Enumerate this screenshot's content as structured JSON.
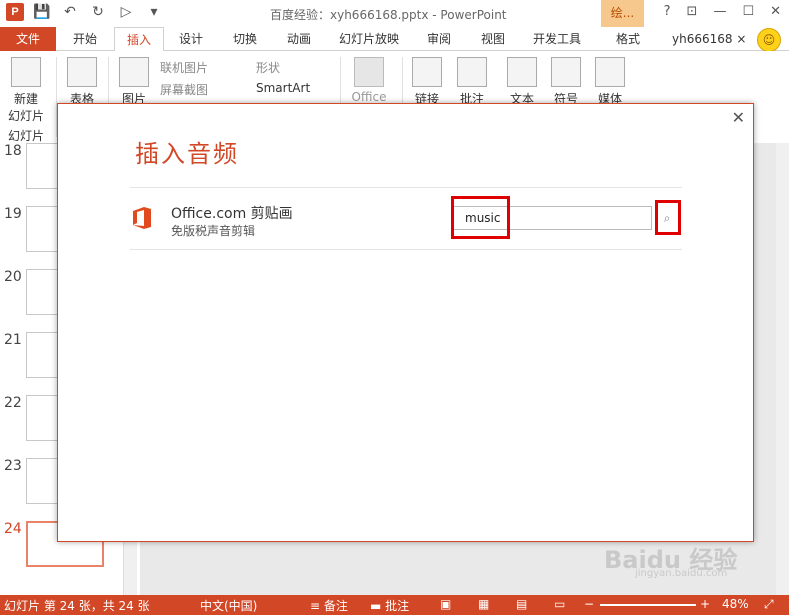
{
  "titlebar": {
    "title": "百度经验：xyh666168.pptx - PowerPoint",
    "app_icon": "P",
    "context_tab": "绘...",
    "help": "?",
    "restore_icon": "⊡",
    "minimize": "—",
    "maximize": "☐",
    "close": "✕"
  },
  "tabs": {
    "file": "文件",
    "home": "开始",
    "insert": "插入",
    "design": "设计",
    "transitions": "切换",
    "animations": "动画",
    "slideshow": "幻灯片放映",
    "review": "审阅",
    "view": "视图",
    "developer": "开发工具",
    "format": "格式",
    "user": "yh666168 ×"
  },
  "ribbon": {
    "new_slide": "新建",
    "new_slide_2": "幻灯片",
    "table": "表格",
    "pictures": "图片",
    "online_pictures": "联机图片",
    "screenshot": "屏幕截图",
    "shapes": "形状",
    "smartart": "SmartArt",
    "office_addins": "Office",
    "link": "链接",
    "comment": "批注",
    "text": "文本",
    "symbol": "符号",
    "media": "媒体",
    "group_slides": "幻灯片"
  },
  "thumbs": {
    "items": [
      {
        "num": "18"
      },
      {
        "num": "19"
      },
      {
        "num": "20"
      },
      {
        "num": "21"
      },
      {
        "num": "22"
      },
      {
        "num": "23"
      },
      {
        "num": "24"
      }
    ]
  },
  "dialog": {
    "title": "插入音频",
    "source_name": "Office.com 剪贴画",
    "source_desc": "免版税声音剪辑",
    "search_value": "music",
    "close": "✕"
  },
  "statusbar": {
    "slide_info": "幻灯片 第 24 张，共 24 张",
    "language": "中文(中国)",
    "notes": "备注",
    "comments": "批注",
    "zoom": "48%"
  },
  "watermark": {
    "main": "Baidu 经验",
    "sub": "jingyan.baidu.com"
  },
  "colors": {
    "accent": "#d24726",
    "highlight": "#e00000"
  }
}
